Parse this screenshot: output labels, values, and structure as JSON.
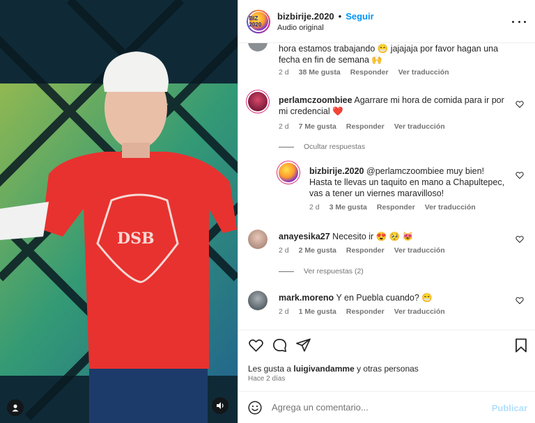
{
  "header": {
    "username": "bizbirije.2020",
    "separator": "•",
    "follow_label": "Seguir",
    "audio_label": "Audio original",
    "avatar_text": "BIZ 2020"
  },
  "comments": [
    {
      "username": "",
      "text": "hora estamos trabajando 😁 jajajaja por favor hagan una fecha en fin de semana 🙌",
      "time": "2 d",
      "likes": "38 Me gusta",
      "reply_label": "Responder",
      "translate_label": "Ver traducción"
    },
    {
      "username": "perlamczoombiee",
      "text": "Agarrare mi hora de comida para ir por mi credencial ❤️",
      "time": "2 d",
      "likes": "7 Me gusta",
      "reply_label": "Responder",
      "translate_label": "Ver traducción"
    },
    {
      "username": "bizbirije.2020",
      "text": "@perlamczoombiee muy bien! Hasta te llevas un taquito en mano a Chapultepec, vas a tener un viernes maravilloso!",
      "time": "2 d",
      "likes": "3 Me gusta",
      "reply_label": "Responder",
      "translate_label": "Ver traducción"
    },
    {
      "username": "anayesika27",
      "text": "Necesito ir 😍 🥺 😻",
      "time": "2 d",
      "likes": "2 Me gusta",
      "reply_label": "Responder",
      "translate_label": "Ver traducción"
    },
    {
      "username": "mark.moreno",
      "text": "Y en Puebla cuando? 😁",
      "time": "2 d",
      "likes": "1 Me gusta",
      "reply_label": "Responder",
      "translate_label": "Ver traducción"
    }
  ],
  "hide_replies_label": "Ocultar respuestas",
  "view_replies_label": "Ver respuestas (2)",
  "likes_line": {
    "prefix": "Les gusta a",
    "user": "luigivandamme",
    "suffix": "y otras personas"
  },
  "posted_time": "Hace 2 días",
  "add_comment": {
    "placeholder": "Agrega un comentario...",
    "post_label": "Publicar"
  },
  "colors": {
    "follow_blue": "#0095f6",
    "post_disabled": "#b2dffc",
    "heart_red": "#ed4956",
    "shirt_red": "#e8322f"
  },
  "icons": [
    "user-icon",
    "volume-icon",
    "more-icon",
    "heart-icon",
    "comment-icon",
    "share-icon",
    "bookmark-icon",
    "emoji-icon"
  ]
}
